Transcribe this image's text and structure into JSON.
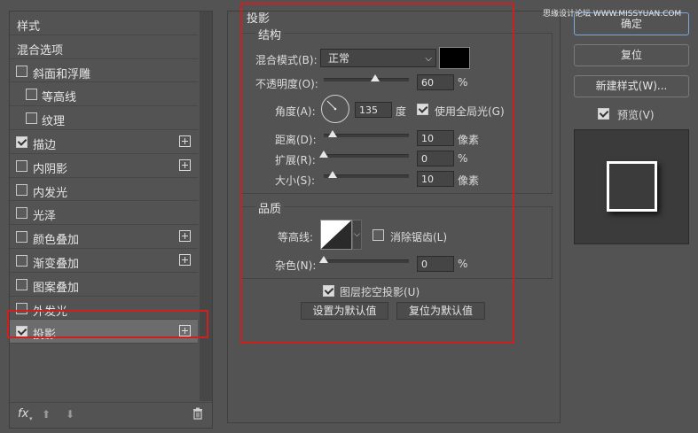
{
  "left": {
    "items": [
      {
        "label": "样式",
        "checkbox": false,
        "checked": false,
        "plus": false,
        "indent": false,
        "selected": false
      },
      {
        "label": "混合选项",
        "checkbox": false,
        "checked": false,
        "plus": false,
        "indent": false,
        "selected": false
      },
      {
        "label": "斜面和浮雕",
        "checkbox": true,
        "checked": false,
        "plus": false,
        "indent": false,
        "selected": false
      },
      {
        "label": "等高线",
        "checkbox": true,
        "checked": false,
        "plus": false,
        "indent": true,
        "selected": false
      },
      {
        "label": "纹理",
        "checkbox": true,
        "checked": false,
        "plus": false,
        "indent": true,
        "selected": false
      },
      {
        "label": "描边",
        "checkbox": true,
        "checked": true,
        "plus": true,
        "indent": false,
        "selected": false
      },
      {
        "label": "内阴影",
        "checkbox": true,
        "checked": false,
        "plus": true,
        "indent": false,
        "selected": false
      },
      {
        "label": "内发光",
        "checkbox": true,
        "checked": false,
        "plus": false,
        "indent": false,
        "selected": false
      },
      {
        "label": "光泽",
        "checkbox": true,
        "checked": false,
        "plus": false,
        "indent": false,
        "selected": false
      },
      {
        "label": "颜色叠加",
        "checkbox": true,
        "checked": false,
        "plus": true,
        "indent": false,
        "selected": false
      },
      {
        "label": "渐变叠加",
        "checkbox": true,
        "checked": false,
        "plus": true,
        "indent": false,
        "selected": false
      },
      {
        "label": "图案叠加",
        "checkbox": true,
        "checked": false,
        "plus": false,
        "indent": false,
        "selected": false
      },
      {
        "label": "外发光",
        "checkbox": true,
        "checked": false,
        "plus": false,
        "indent": false,
        "selected": false
      },
      {
        "label": "投影",
        "checkbox": true,
        "checked": true,
        "plus": true,
        "indent": false,
        "selected": true
      }
    ],
    "bottom": {
      "fx": "fx"
    }
  },
  "panel": {
    "title": "投影",
    "structure": {
      "title": "结构",
      "blend_mode_label": "混合模式(B):",
      "blend_mode_value": "正常",
      "opacity_label": "不透明度(O):",
      "opacity_value": "60",
      "opacity_unit": "%",
      "angle_label": "角度(A):",
      "angle_value": "135",
      "angle_unit": "度",
      "global_light_label": "使用全局光(G)",
      "distance_label": "距离(D):",
      "distance_value": "10",
      "distance_unit": "像素",
      "spread_label": "扩展(R):",
      "spread_value": "0",
      "spread_unit": "%",
      "size_label": "大小(S):",
      "size_value": "10",
      "size_unit": "像素"
    },
    "quality": {
      "title": "品质",
      "contour_label": "等高线:",
      "antialias_label": "消除锯齿(L)",
      "noise_label": "杂色(N):",
      "noise_value": "0",
      "noise_unit": "%"
    },
    "knockout_label": "图层挖空投影(U)",
    "make_default": "设置为默认值",
    "reset_default": "复位为默认值"
  },
  "right": {
    "ok": "确定",
    "reset": "复位",
    "new_style": "新建样式(W)...",
    "preview_label": "预览(V)"
  },
  "watermark": "思缘设计论坛 WWW.MISSYUAN.COM",
  "colors": {
    "shadow_color": "#000000",
    "highlight": "#d0201e",
    "bg": "#535353"
  }
}
